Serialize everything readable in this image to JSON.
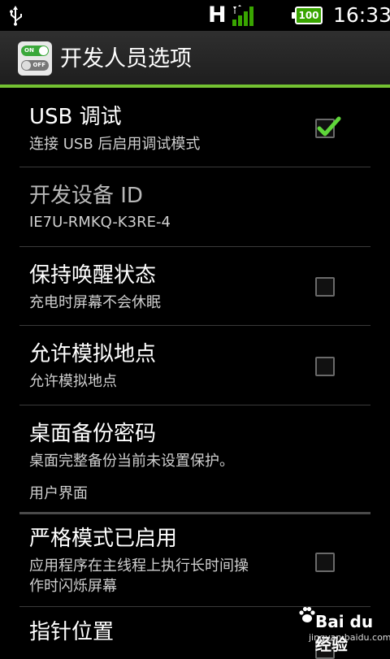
{
  "status_bar": {
    "network_type": "H",
    "battery_level": "100",
    "time": "16:33",
    "icons": [
      "usb-icon",
      "signal-icon",
      "battery-icon"
    ]
  },
  "header": {
    "title": "开发人员选项",
    "app_icon_on_label": "ON",
    "app_icon_off_label": "OFF",
    "accent_color": "#74c132"
  },
  "items": [
    {
      "title": "USB 调试",
      "subtitle": "连接 USB 后启用调试模式",
      "checkbox": true,
      "checked": true
    },
    {
      "title": "开发设备 ID",
      "subtitle": "IE7U-RMKQ-K3RE-4",
      "checkbox": false,
      "disabled": true
    },
    {
      "title": "保持唤醒状态",
      "subtitle": "充电时屏幕不会休眠",
      "checkbox": true,
      "checked": false
    },
    {
      "title": "允许模拟地点",
      "subtitle": "允许模拟地点",
      "checkbox": true,
      "checked": false
    },
    {
      "title": "桌面备份密码",
      "subtitle": "桌面完整备份当前未设置保护。",
      "checkbox": false
    }
  ],
  "section": {
    "label": "用户界面"
  },
  "items2": [
    {
      "title": "严格模式已启用",
      "subtitle_line1": "应用程序在主线程上执行长时间操",
      "subtitle_line2": "作时闪烁屏幕",
      "checkbox": true,
      "checked": false
    },
    {
      "title": "指针位置",
      "checkbox": true,
      "checked": false
    }
  ],
  "watermark": {
    "brand": "Bai du 经验",
    "url": "jingyan.baidu.com"
  }
}
